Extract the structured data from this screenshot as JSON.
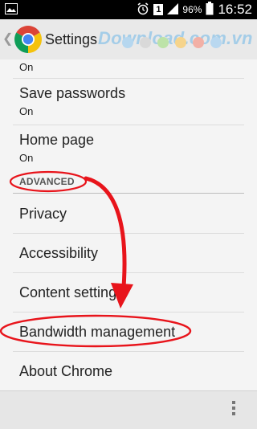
{
  "status_bar": {
    "battery": "96%",
    "time": "16:52",
    "sim": "1"
  },
  "header": {
    "title": "Settings",
    "watermark": "Download.com.vn"
  },
  "settings": {
    "top_partial": {
      "value": "On"
    },
    "save_passwords": {
      "label": "Save passwords",
      "value": "On"
    },
    "home_page": {
      "label": "Home page",
      "value": "On"
    },
    "advanced_header": "ADVANCED",
    "privacy": "Privacy",
    "accessibility": "Accessibility",
    "content_settings": "Content settings",
    "bandwidth": "Bandwidth management",
    "about": "About Chrome"
  },
  "colors": {
    "annotation": "#e8141b",
    "watermark": "#4aa8e8",
    "dots": [
      "#b6d7ef",
      "#d9d9d9",
      "#bde3a8",
      "#f6d48c",
      "#f2b0a6",
      "#b9d8f0"
    ]
  }
}
